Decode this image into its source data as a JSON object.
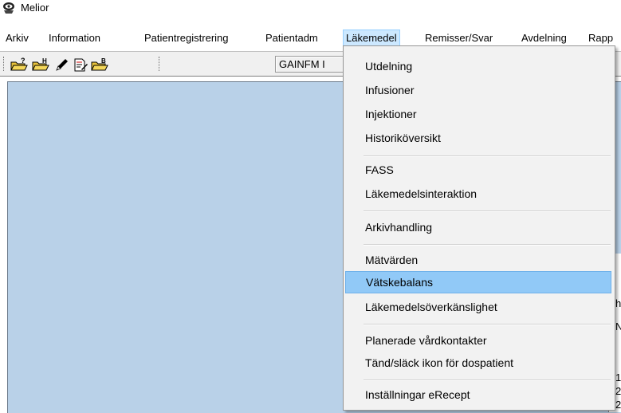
{
  "window": {
    "title": "Melior"
  },
  "menubar": {
    "items": [
      {
        "label": "Arkiv"
      },
      {
        "label": "Information"
      },
      {
        "label": "Patientregistrering"
      },
      {
        "label": "Patientadm"
      },
      {
        "label": "Läkemedel"
      },
      {
        "label": "Remisser/Svar"
      },
      {
        "label": "Avdelning"
      },
      {
        "label": "Rapp"
      }
    ]
  },
  "toolbar": {
    "field_text": "GAINFM I",
    "buttons": [
      {
        "icon": "folder-question-icon"
      },
      {
        "icon": "folder-h-icon"
      },
      {
        "icon": "pencil-icon"
      },
      {
        "icon": "document-edit-icon"
      },
      {
        "icon": "folder-b-icon"
      }
    ]
  },
  "dropdown": {
    "items": [
      {
        "label": "Utdelning"
      },
      {
        "label": "Infusioner"
      },
      {
        "label": "Injektioner"
      },
      {
        "label": "Historiköversikt"
      },
      {
        "label": "FASS"
      },
      {
        "label": "Läkemedelsinteraktion"
      },
      {
        "label": "Arkivhandling"
      },
      {
        "label": "Mätvärden"
      },
      {
        "label": "Vätskebalans"
      },
      {
        "label": "Läkemedelsöverkänslighet"
      },
      {
        "label": "Planerade vårdkontakter"
      },
      {
        "label": "Tänd/släck ikon för dospatient"
      },
      {
        "label": "Inställningar eRecept"
      }
    ],
    "highlighted": "Vätskebalans"
  },
  "side_panel": {
    "fragments": [
      "h",
      "N",
      "1",
      "2",
      "2"
    ]
  },
  "colors": {
    "client_bg": "#b9d1e8",
    "menu_active_bg": "#cce8ff",
    "dropdown_bg": "#f2f2f2",
    "highlight_bg": "#91c9f7"
  }
}
